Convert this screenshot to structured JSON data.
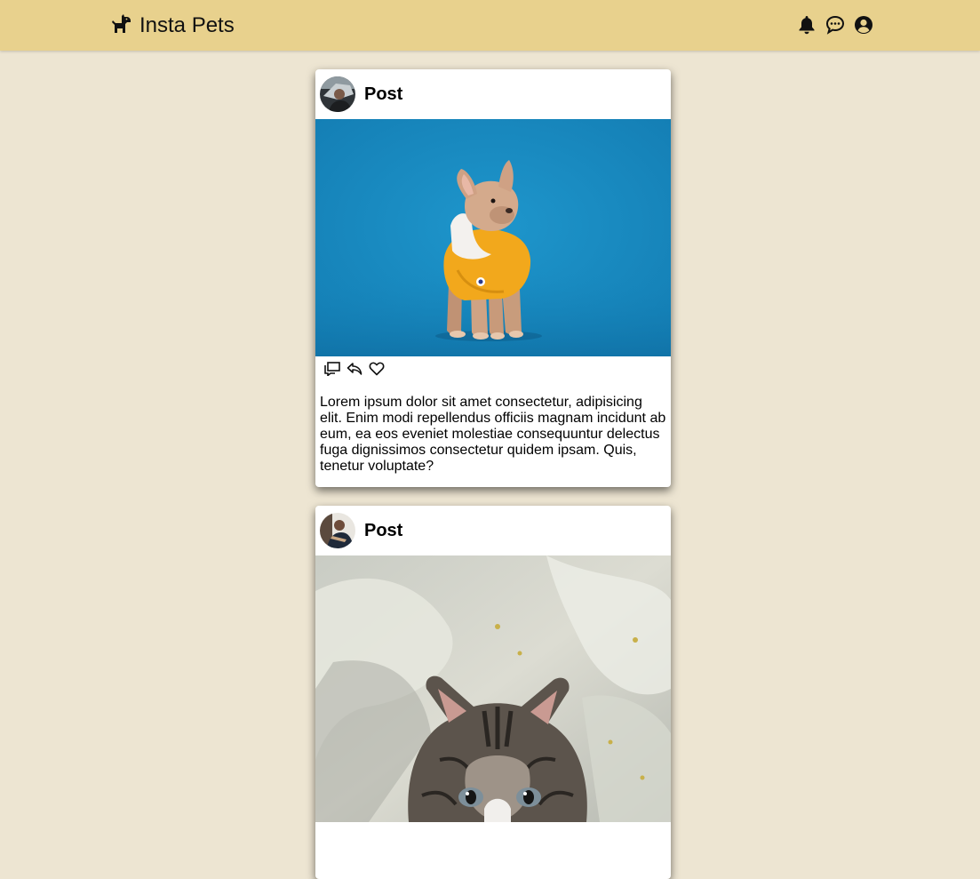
{
  "app": {
    "title": "Insta Pets",
    "logo_icon": "dog-icon"
  },
  "nav": {
    "icons": [
      "bell-icon",
      "chat-bubble-icon",
      "user-circle-icon"
    ]
  },
  "posts": [
    {
      "title": "Post",
      "avatar": "user-avatar-photo",
      "image": "french-bulldog-in-yellow-sweater-photo",
      "actions": [
        "comment-icon",
        "share-icon",
        "heart-icon"
      ],
      "caption": "Lorem ipsum dolor sit amet consectetur, adipisicing elit. Enim modi repellendus officiis magnam incidunt ab eum, ea eos eveniet molestiae consequuntur delectus fuga dignissimos consectetur quidem ipsam. Quis, tenetur voluptate?"
    },
    {
      "title": "Post",
      "avatar": "user-avatar-photo",
      "image": "tabby-kitten-on-blanket-photo"
    }
  ],
  "colors": {
    "navbar": "#e8d18d",
    "page_background": "#ede5d2",
    "card": "#ffffff",
    "photo_backdrop_blue": "#1a8cc4"
  }
}
